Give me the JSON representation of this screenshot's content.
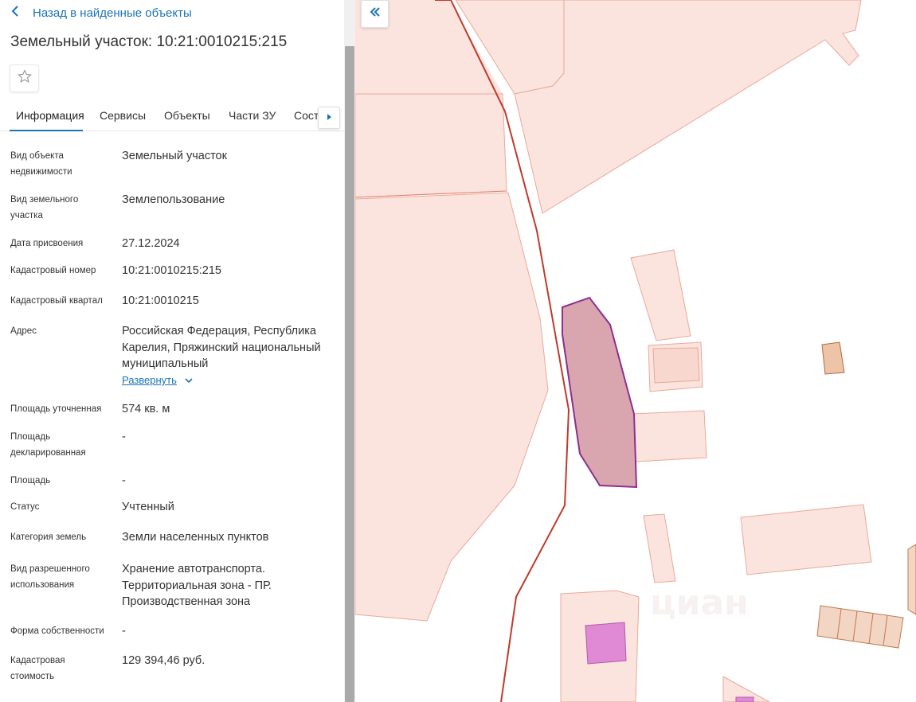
{
  "back_link": {
    "label": "Назад в найденные объекты",
    "icon": "chevron-left-icon"
  },
  "title": "Земельный участок: 10:21:0010215:215",
  "favorite": {
    "icon": "star-icon"
  },
  "tabs": [
    {
      "label": "Информация",
      "active": true
    },
    {
      "label": "Сервисы",
      "active": false
    },
    {
      "label": "Объекты",
      "active": false
    },
    {
      "label": "Части ЗУ",
      "active": false
    },
    {
      "label": "Состав",
      "active": false
    }
  ],
  "info": {
    "object_type": {
      "label": "Вид объекта недвижимости",
      "value": "Земельный участок"
    },
    "land_type": {
      "label": "Вид земельного участка",
      "value": "Землепользование"
    },
    "assigned_date": {
      "label": "Дата присвоения",
      "value": "27.12.2024"
    },
    "cadastral_number": {
      "label": "Кадастровый номер",
      "value": "10:21:0010215:215"
    },
    "cadastral_quarter": {
      "label": "Кадастровый квартал",
      "value": "10:21:0010215"
    },
    "address": {
      "label": "Адрес",
      "value": "Российская Федерация, Республика Карелия, Пряжинский национальный муниципальный",
      "expand_label": "Развернуть"
    },
    "area_refined": {
      "label": "Площадь уточненная",
      "value": "574 кв. м"
    },
    "area_declared": {
      "label": "Площадь декларированная",
      "value": "-"
    },
    "area": {
      "label": "Площадь",
      "value": "-"
    },
    "status": {
      "label": "Статус",
      "value": "Учтенный"
    },
    "land_category": {
      "label": "Категория земель",
      "value": "Земли населенных пунктов"
    },
    "permitted_use": {
      "label": "Вид разрешенного использования",
      "value": "Хранение автотранспорта. Территориальная зона - ПР. Производственная зона"
    },
    "ownership_form": {
      "label": "Форма собственности",
      "value": "-"
    },
    "cadastral_value": {
      "label": "Кадастровая стоимость",
      "value": "129 394,46 руб."
    }
  },
  "map": {
    "collapse_icon": "double-chevron-left-icon",
    "colors": {
      "parcel_fill": "#fbe4de",
      "parcel_stroke": "#e8a99a",
      "boundary_line": "#c0392b",
      "selected_fill": "#d9a6b0",
      "selected_stroke": "#8e2e8e",
      "building_fill": "#f2d5c2",
      "building_stroke": "#c07a50",
      "magenta": "#e08ad6"
    }
  }
}
